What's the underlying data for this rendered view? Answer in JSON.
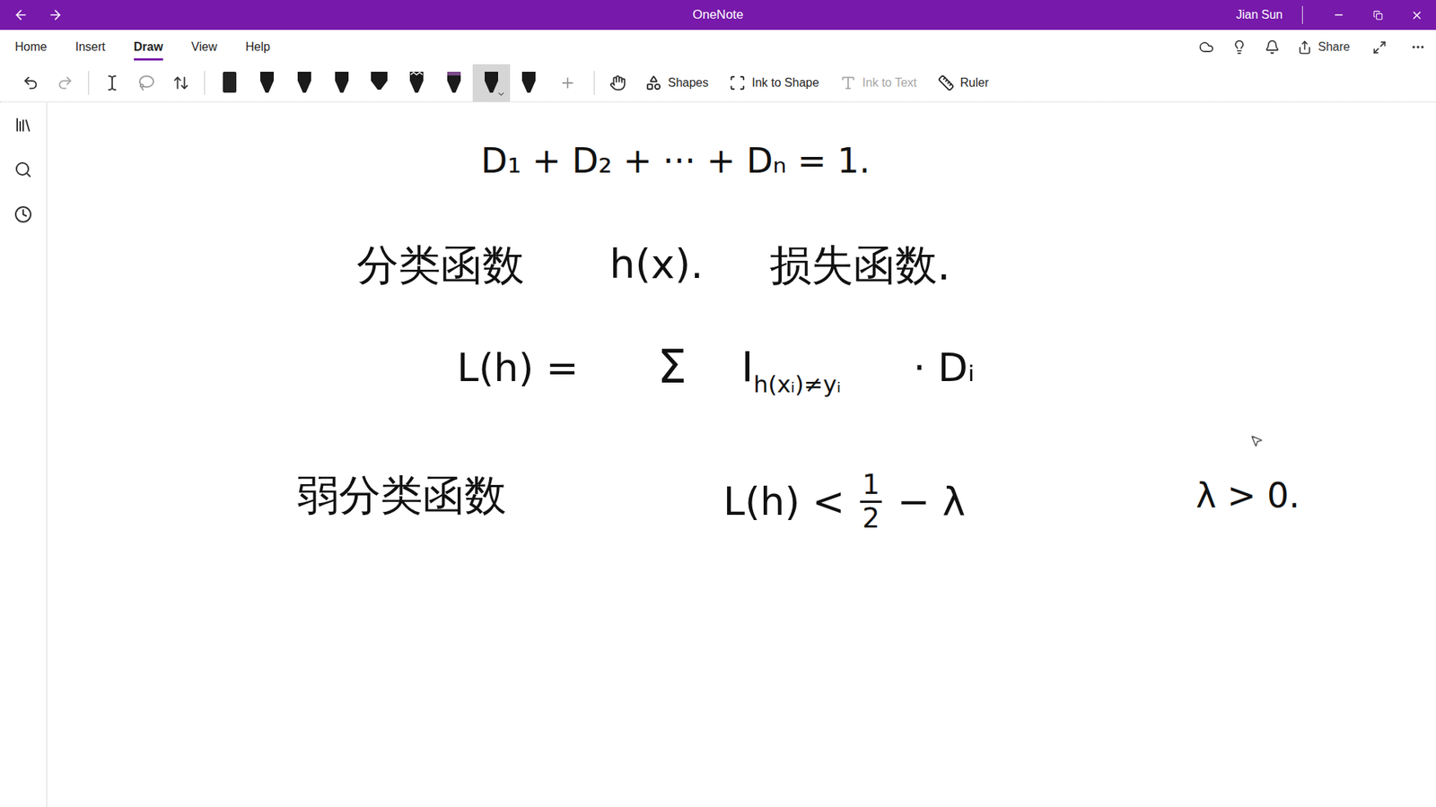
{
  "window": {
    "app": "OneNote",
    "user": "Jian Sun"
  },
  "menu": [
    {
      "label": "Home",
      "selected": false
    },
    {
      "label": "Insert",
      "selected": false
    },
    {
      "label": "Draw",
      "selected": true
    },
    {
      "label": "View",
      "selected": false
    },
    {
      "label": "Help",
      "selected": false
    }
  ],
  "share": "Share",
  "pens": [
    {
      "selected": false
    },
    {
      "selected": false
    },
    {
      "selected": false
    },
    {
      "selected": false
    },
    {
      "selected": false
    },
    {
      "selected": false
    },
    {
      "selected": false
    },
    {
      "selected": true
    },
    {
      "selected": false
    }
  ],
  "tools": [
    {
      "label": "Shapes",
      "disabled": false
    },
    {
      "label": "Ink to Shape",
      "disabled": false
    },
    {
      "label": "Ink to Text",
      "disabled": true
    },
    {
      "label": "Ruler",
      "disabled": false
    }
  ],
  "ink": [
    [
      {
        "text": "D₁ + D₂ + ··· + Dₙ = 1."
      }
    ],
    [
      {
        "text": "分类函数"
      }
    ],
    [
      {
        "text": "h(x)."
      }
    ],
    [
      {
        "text": "损失函数."
      }
    ],
    [
      {
        "text": "L(h) ="
      }
    ],
    [
      {
        "text": "Σ"
      }
    ],
    [
      {
        "text": "I"
      },
      {
        "sub": "h(xᵢ)≠yᵢ"
      }
    ],
    [
      {
        "text": "· Dᵢ"
      }
    ],
    [
      {
        "text": "弱分类函数"
      }
    ],
    [
      {
        "text": "L(h) < "
      },
      {
        "num": "1",
        "den": "2"
      },
      {
        "text": " − λ"
      }
    ],
    [
      {
        "text": "λ > 0."
      }
    ]
  ]
}
